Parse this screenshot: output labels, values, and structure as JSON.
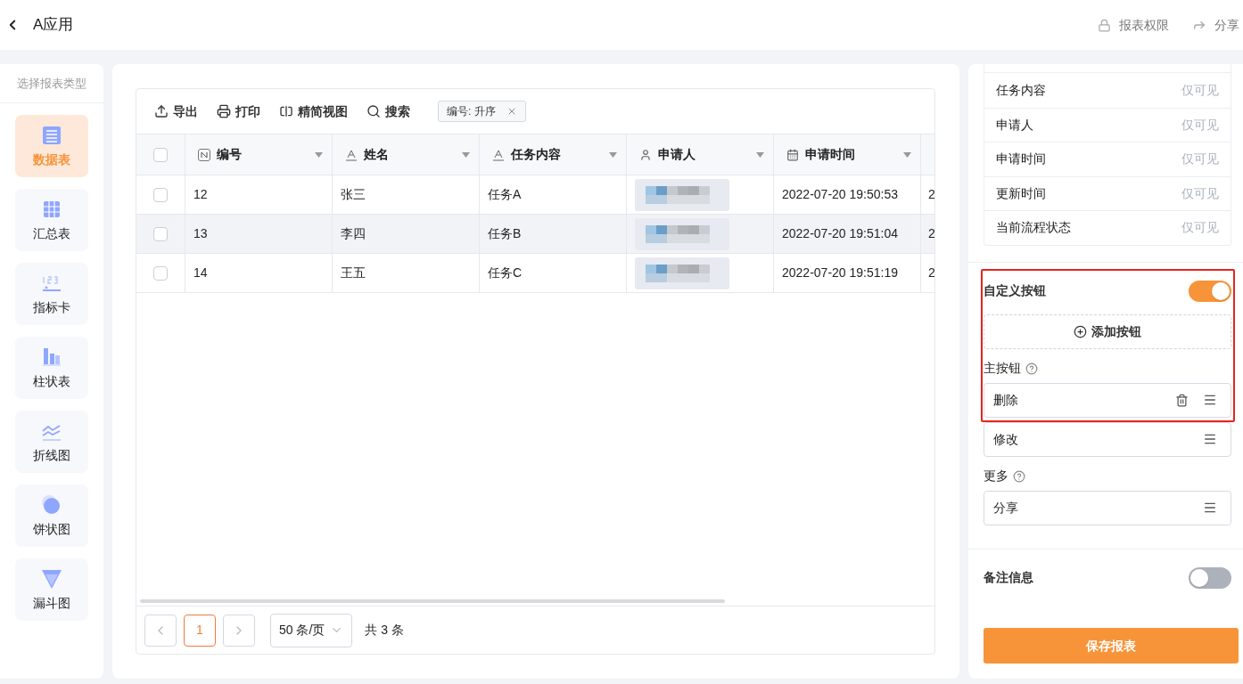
{
  "header": {
    "title": "A应用",
    "actions": [
      {
        "label": "报表权限",
        "kind": "lock"
      },
      {
        "label": "分享",
        "kind": "share"
      }
    ]
  },
  "sidebar": {
    "title": "选择报表类型",
    "items": [
      {
        "label": "数据表",
        "kind": "table",
        "selected": true
      },
      {
        "label": "汇总表",
        "kind": "summary",
        "selected": false
      },
      {
        "label": "指标卡",
        "kind": "metric",
        "selected": false
      },
      {
        "label": "柱状表",
        "kind": "bar",
        "selected": false
      },
      {
        "label": "折线图",
        "kind": "line",
        "selected": false
      },
      {
        "label": "饼状图",
        "kind": "pie",
        "selected": false
      },
      {
        "label": "漏斗图",
        "kind": "funnel",
        "selected": false
      }
    ]
  },
  "toolbar": {
    "actions": [
      {
        "label": "导出",
        "kind": "export"
      },
      {
        "label": "打印",
        "kind": "print"
      },
      {
        "label": "精简视图",
        "kind": "grid"
      },
      {
        "label": "搜索",
        "kind": "search"
      }
    ],
    "sort_tag": "编号: 升序"
  },
  "table": {
    "select_all_checked": false,
    "columns": [
      {
        "label": "编号",
        "kind": "number"
      },
      {
        "label": "姓名",
        "kind": "text"
      },
      {
        "label": "任务内容",
        "kind": "text"
      },
      {
        "label": "申请人",
        "kind": "person"
      },
      {
        "label": "申请时间",
        "kind": "date"
      }
    ],
    "rows": [
      {
        "checked": false,
        "highlighted": false,
        "number": "12",
        "name": "张三",
        "task": "任务A",
        "time": "2022-07-20 19:50:53",
        "column_6": "2"
      },
      {
        "checked": false,
        "highlighted": true,
        "number": "13",
        "name": "李四",
        "task": "任务B",
        "time": "2022-07-20 19:51:04",
        "column_6": "2"
      },
      {
        "checked": false,
        "highlighted": false,
        "number": "14",
        "name": "王五",
        "task": "任务C",
        "time": "2022-07-20 19:51:19",
        "column_6": "2"
      }
    ]
  },
  "pagination": {
    "pages": [
      {
        "label": "1",
        "selected": true
      }
    ],
    "page_size": "50 条/页",
    "total": "共 3 条"
  },
  "field_permissions": [
    {
      "label": "任务内容",
      "permission": "仅可见"
    },
    {
      "label": "申请人",
      "permission": "仅可见"
    },
    {
      "label": "申请时间",
      "permission": "仅可见"
    },
    {
      "label": "更新时间",
      "permission": "仅可见"
    },
    {
      "label": "当前流程状态",
      "permission": "仅可见"
    }
  ],
  "custom_buttons": {
    "label": "自定义按钮",
    "on": true,
    "add_label": "添加按钮",
    "groups": [
      {
        "label": "主按钮",
        "buttons": [
          {
            "label": "删除",
            "deletable": true
          },
          {
            "label": "修改",
            "deletable": false
          }
        ]
      },
      {
        "label": "更多",
        "buttons": [
          {
            "label": "分享",
            "deletable": false
          }
        ]
      }
    ]
  },
  "notes": {
    "label": "备注信息",
    "on": false
  },
  "save_button": "保存报表"
}
